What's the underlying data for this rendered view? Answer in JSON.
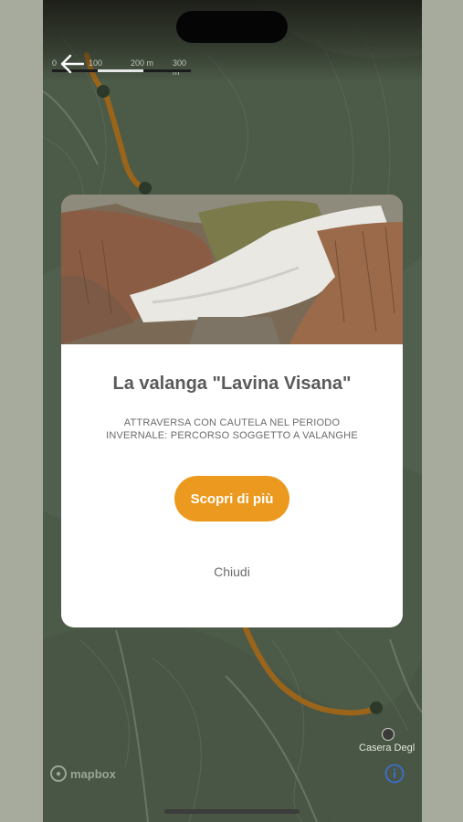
{
  "map": {
    "scale_labels": [
      "0",
      "100",
      "200 m",
      "300 m"
    ],
    "poi_label": "Casera Degl",
    "attribution": "mapbox",
    "info_icon": "info-circle-icon",
    "route_color": "#c67a16"
  },
  "navigation": {
    "back_icon": "arrow-left-icon"
  },
  "modal": {
    "title": "La valanga \"Lavina Visana\"",
    "subtitle": "ATTRAVERSA CON CAUTELA NEL PERIODO INVERNALE: PERCORSO SOGGETTO A VALANGHE",
    "cta_label": "Scopri di più",
    "close_label": "Chiudi",
    "accent_color": "#eb9a1f"
  }
}
